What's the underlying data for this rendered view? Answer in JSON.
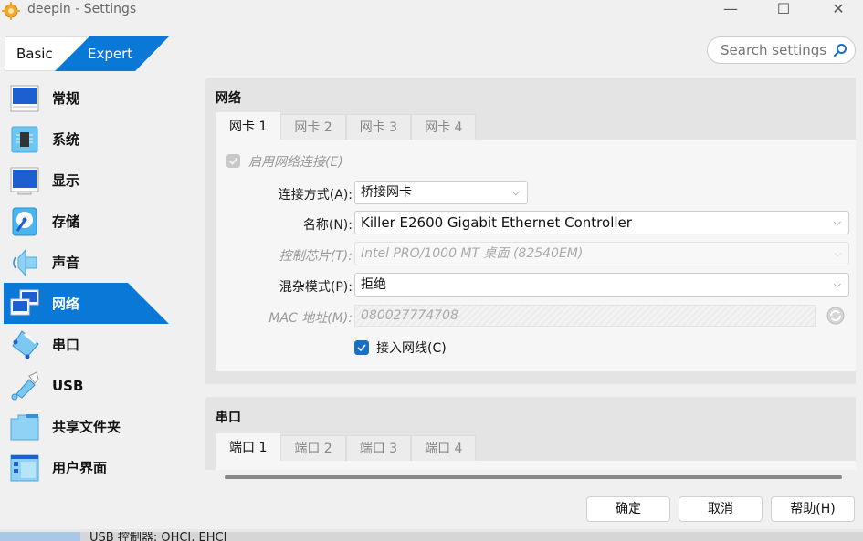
{
  "window": {
    "title": "deepin - Settings",
    "controls": {
      "minimize": "—",
      "maximize": "☐",
      "close": "✕"
    }
  },
  "mode_toggle": {
    "basic_label": "Basic",
    "expert_label": "Expert",
    "active": "Expert"
  },
  "search": {
    "placeholder": "Search settings",
    "value": ""
  },
  "sidebar": {
    "items": [
      {
        "label": "常规",
        "icon": "general-monitor-icon"
      },
      {
        "label": "系统",
        "icon": "system-chip-icon"
      },
      {
        "label": "显示",
        "icon": "display-monitor-icon"
      },
      {
        "label": "存储",
        "icon": "storage-disk-icon"
      },
      {
        "label": "声音",
        "icon": "audio-speaker-icon"
      },
      {
        "label": "网络",
        "icon": "network-icon",
        "active": true
      },
      {
        "label": "串口",
        "icon": "serial-port-icon"
      },
      {
        "label": "USB",
        "icon": "usb-icon"
      },
      {
        "label": "共享文件夹",
        "icon": "shared-folder-icon"
      },
      {
        "label": "用户界面",
        "icon": "user-interface-icon"
      }
    ]
  },
  "network": {
    "title": "网络",
    "tabs": [
      "网卡 1",
      "网卡 2",
      "网卡 3",
      "网卡 4"
    ],
    "active_tab": "网卡 1",
    "enable_label": "启用网络连接(E)",
    "enable_checked": true,
    "attached_label": "连接方式(A):",
    "attached_value": "桥接网卡",
    "name_label": "名称(N):",
    "name_value": "Killer E2600 Gigabit Ethernet Controller",
    "adapter_label": "控制芯片(T):",
    "adapter_value": "Intel PRO/1000 MT 桌面 (82540EM)",
    "promisc_label": "混杂模式(P):",
    "promisc_value": "拒绝",
    "mac_label": "MAC 地址(M):",
    "mac_value": "080027774708",
    "cable_label": "接入网线(C)",
    "cable_checked": true
  },
  "serial": {
    "title": "串口",
    "tabs": [
      "端口 1",
      "端口 2",
      "端口 3",
      "端口 4"
    ],
    "active_tab": "端口 1"
  },
  "buttons": {
    "ok": "确定",
    "cancel": "取消",
    "help": "帮助(H)"
  },
  "background_window": {
    "text": "USB 控制器:   OHCI, EHCI"
  },
  "colors": {
    "accent": "#0a78d7",
    "checkbox": "#1a6fc4"
  }
}
